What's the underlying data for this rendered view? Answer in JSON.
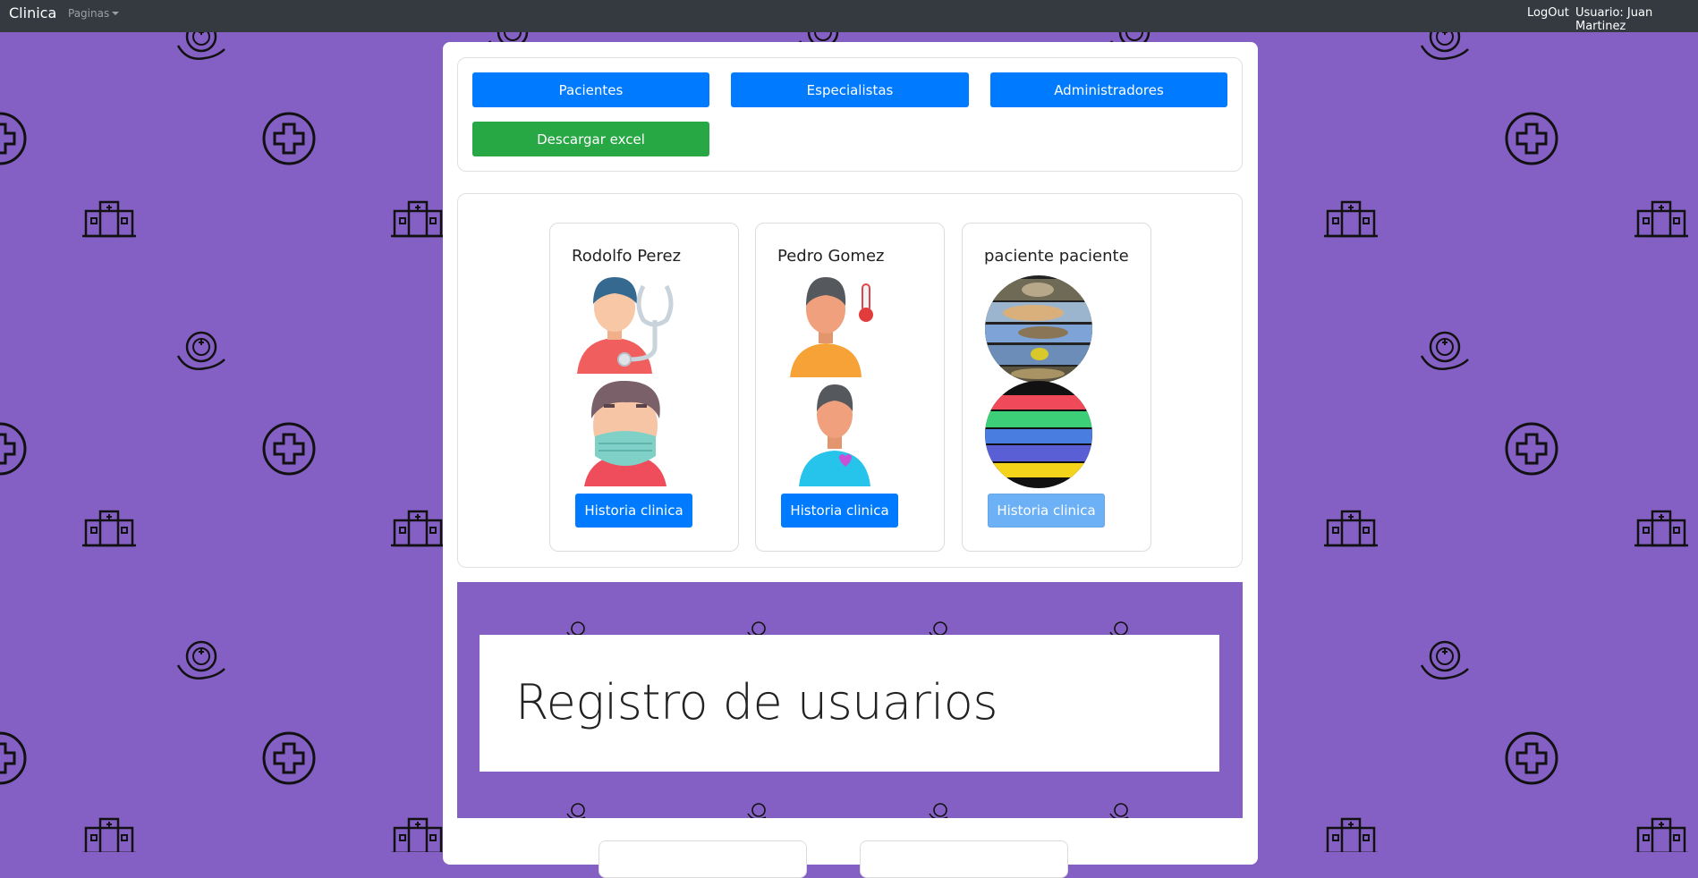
{
  "navbar": {
    "brand": "Clinica",
    "pages_dropdown": "Paginas",
    "logout": "LogOut",
    "user_label": "Usuario: Juan Martinez"
  },
  "toolbar": {
    "pacientes": "Pacientes",
    "especialistas": "Especialistas",
    "administradores": "Administradores",
    "excel": "Descargar excel"
  },
  "patients": [
    {
      "name": "Rodolfo Perez",
      "button": "Historia clinica",
      "avatar1": "doctor-stethoscope-icon",
      "avatar2": "masked-person-icon"
    },
    {
      "name": "Pedro Gomez",
      "button": "Historia clinica",
      "avatar1": "person-thermometer-icon",
      "avatar2": "person-heart-icon"
    },
    {
      "name": "paciente paciente",
      "button": "Historia clinica",
      "avatar1": "photo-collage-icon",
      "avatar2": "color-stripes-icon"
    }
  ],
  "registro": {
    "title": "Registro de usuarios"
  },
  "colors": {
    "background": "#8560c4",
    "navbar": "#343a40",
    "primary": "#007bff",
    "success": "#28a745"
  }
}
